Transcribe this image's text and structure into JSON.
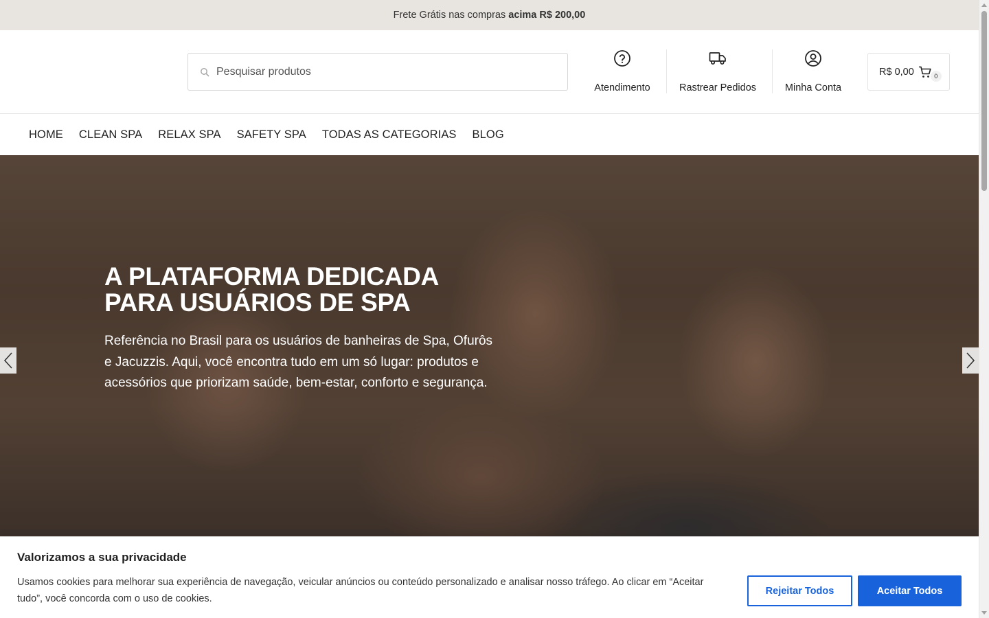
{
  "topbar": {
    "text": "Frete Grátis nas compras",
    "bold": "acima R$ 200,00"
  },
  "header": {
    "search_placeholder": "Pesquisar produtos",
    "links": [
      {
        "label": "Atendimento",
        "icon": "help-circle-icon"
      },
      {
        "label": "Rastrear Pedidos",
        "icon": "truck-icon"
      },
      {
        "label": "Minha Conta",
        "icon": "user-circle-icon"
      }
    ],
    "cart": {
      "total": "R$ 0,00",
      "count": "0",
      "icon": "cart-icon"
    }
  },
  "nav": [
    "HOME",
    "CLEAN SPA",
    "RELAX SPA",
    "SAFETY SPA",
    "TODAS AS CATEGORIAS",
    "BLOG"
  ],
  "hero": {
    "title_line1": "A PLATAFORMA DEDICADA",
    "title_line2": "PARA USUÁRIOS DE SPA",
    "text": "Referência no Brasil para os usuários de banheiras de Spa, Ofurôs e Jacuzzis. Aqui, você encontra tudo em um só lugar: produtos e acessórios que priorizam saúde, bem-estar, conforto e segurança."
  },
  "cookie": {
    "title": "Valorizamos a sua privacidade",
    "text": "Usamos cookies para melhorar sua experiência de navegação, veicular anúncios ou conteúdo personalizado e analisar nosso tráfego. Ao clicar em “Aceitar tudo”, você concorda com o uso de cookies.",
    "reject_label": "Rejeitar Todos",
    "accept_label": "Aceitar Todos"
  },
  "colors": {
    "topbar_bg": "#e8e4df",
    "accent_blue": "#1863dc"
  }
}
